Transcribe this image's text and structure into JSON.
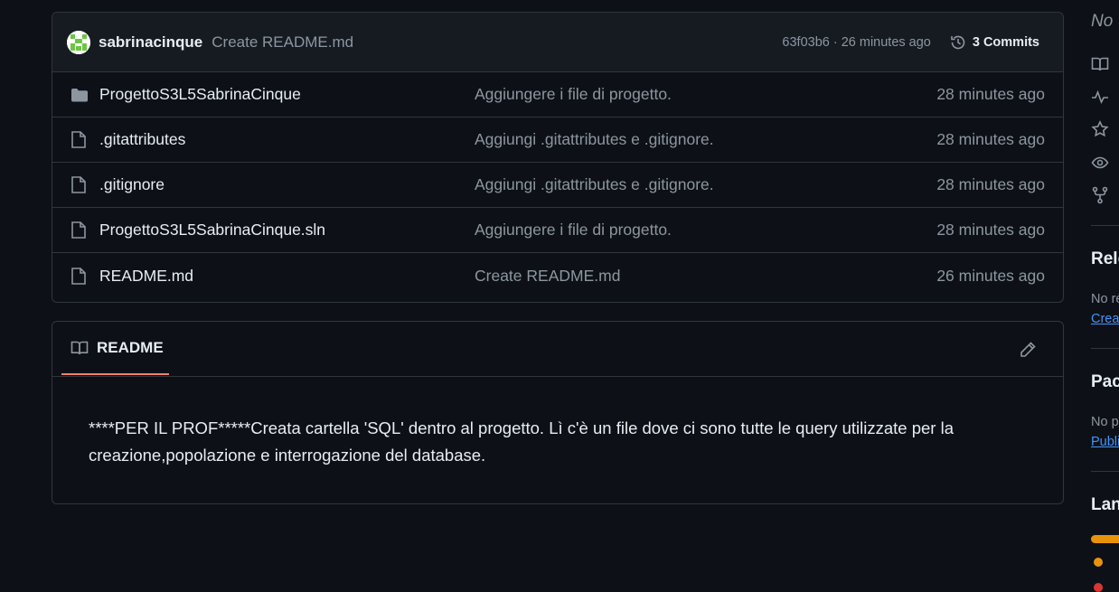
{
  "commit": {
    "author": "sabrinacinque",
    "message": "Create README.md",
    "hash_time": "63f03b6 · 26 minutes ago",
    "commits_label": "3 Commits"
  },
  "files": [
    {
      "icon": "folder-icon",
      "name": "ProgettoS3L5SabrinaCinque",
      "message": "Aggiungere i file di progetto.",
      "time": "28 minutes ago"
    },
    {
      "icon": "file-icon",
      "name": ".gitattributes",
      "message": "Aggiungi .gitattributes e .gitignore.",
      "time": "28 minutes ago"
    },
    {
      "icon": "file-icon",
      "name": ".gitignore",
      "message": "Aggiungi .gitattributes e .gitignore.",
      "time": "28 minutes ago"
    },
    {
      "icon": "file-icon",
      "name": "ProgettoS3L5SabrinaCinque.sln",
      "message": "Aggiungere i file di progetto.",
      "time": "28 minutes ago"
    },
    {
      "icon": "file-icon",
      "name": "README.md",
      "message": "Create README.md",
      "time": "26 minutes ago"
    }
  ],
  "readme": {
    "tab_label": "README",
    "body": "****PER IL PROF*****Creata cartella 'SQL' dentro al progetto. Lì c'è un file dove ci sono tutte le query utilizzate per la creazione,popolazione e interrogazione del database."
  },
  "sidebar": {
    "about_text": "No",
    "releases_heading": "Rele",
    "releases_text": "No re",
    "releases_link": "Creat",
    "packages_heading": "Pac",
    "packages_text": "No p",
    "packages_link": "Publi",
    "languages_heading": "Lan"
  },
  "colors": {
    "background": "#0d1117",
    "border": "#30363d",
    "accent_tab": "#f78166",
    "link": "#4493f8",
    "lang_primary": "#e9930c",
    "lang_secondary": "#da3633"
  }
}
